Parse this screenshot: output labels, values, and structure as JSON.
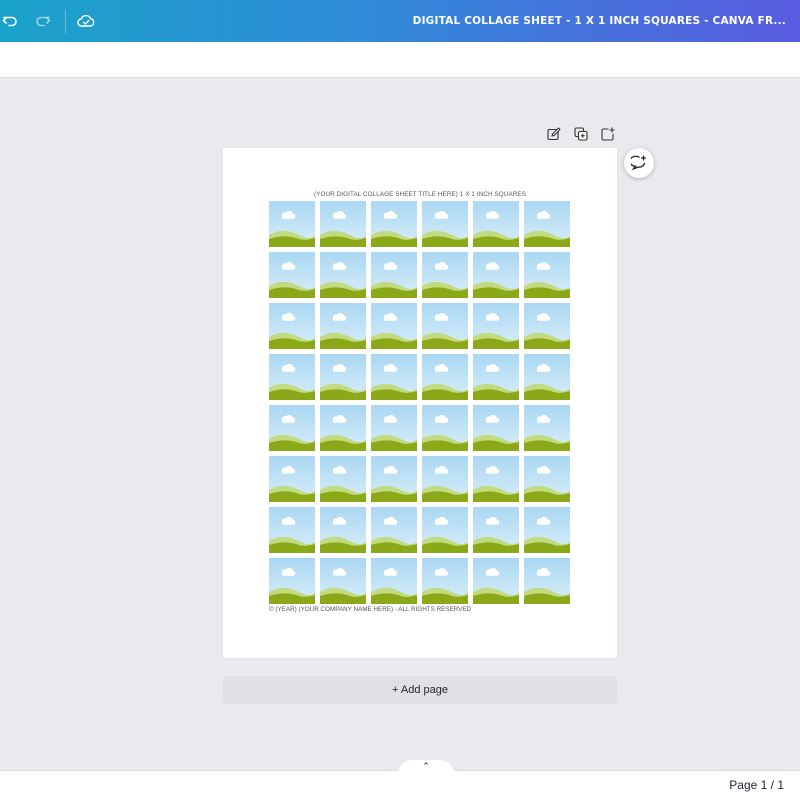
{
  "header": {
    "undo_icon": "undo-icon",
    "redo_icon": "redo-icon",
    "saved_icon": "cloud-check-icon",
    "document_title": "DIGITAL COLLAGE SHEET - 1 X 1 INCH SQUARES - CANVA FR..."
  },
  "page_actions": {
    "edit_notes_icon": "edit-icon",
    "duplicate_icon": "duplicate-icon",
    "add_page_icon": "add-page-icon",
    "comment_icon": "comment-add-icon"
  },
  "page": {
    "sheet_title": "(YOUR DIGITAL COLLAGE SHEET TITLE HERE) 1 X 1 INCH SQUARES",
    "grid_rows": 8,
    "grid_columns": 6,
    "tile_icon": "image-placeholder-icon",
    "copyright": "© (YEAR) (YOUR COMPANY NAME HERE) - ALL RIGHTS RESERVED"
  },
  "add_page_label": "+ Add page",
  "footer": {
    "collapse_icon": "chevron-up-icon",
    "collapse_glyph": "⌃",
    "page_indicator": "Page 1 / 1"
  },
  "colors": {
    "header_gradient_start": "#1aa3c9",
    "header_gradient_end": "#5a5be0",
    "canvas_bg": "#e9eaee",
    "sky": "#a9d7f2",
    "grass": "#8aa817"
  }
}
